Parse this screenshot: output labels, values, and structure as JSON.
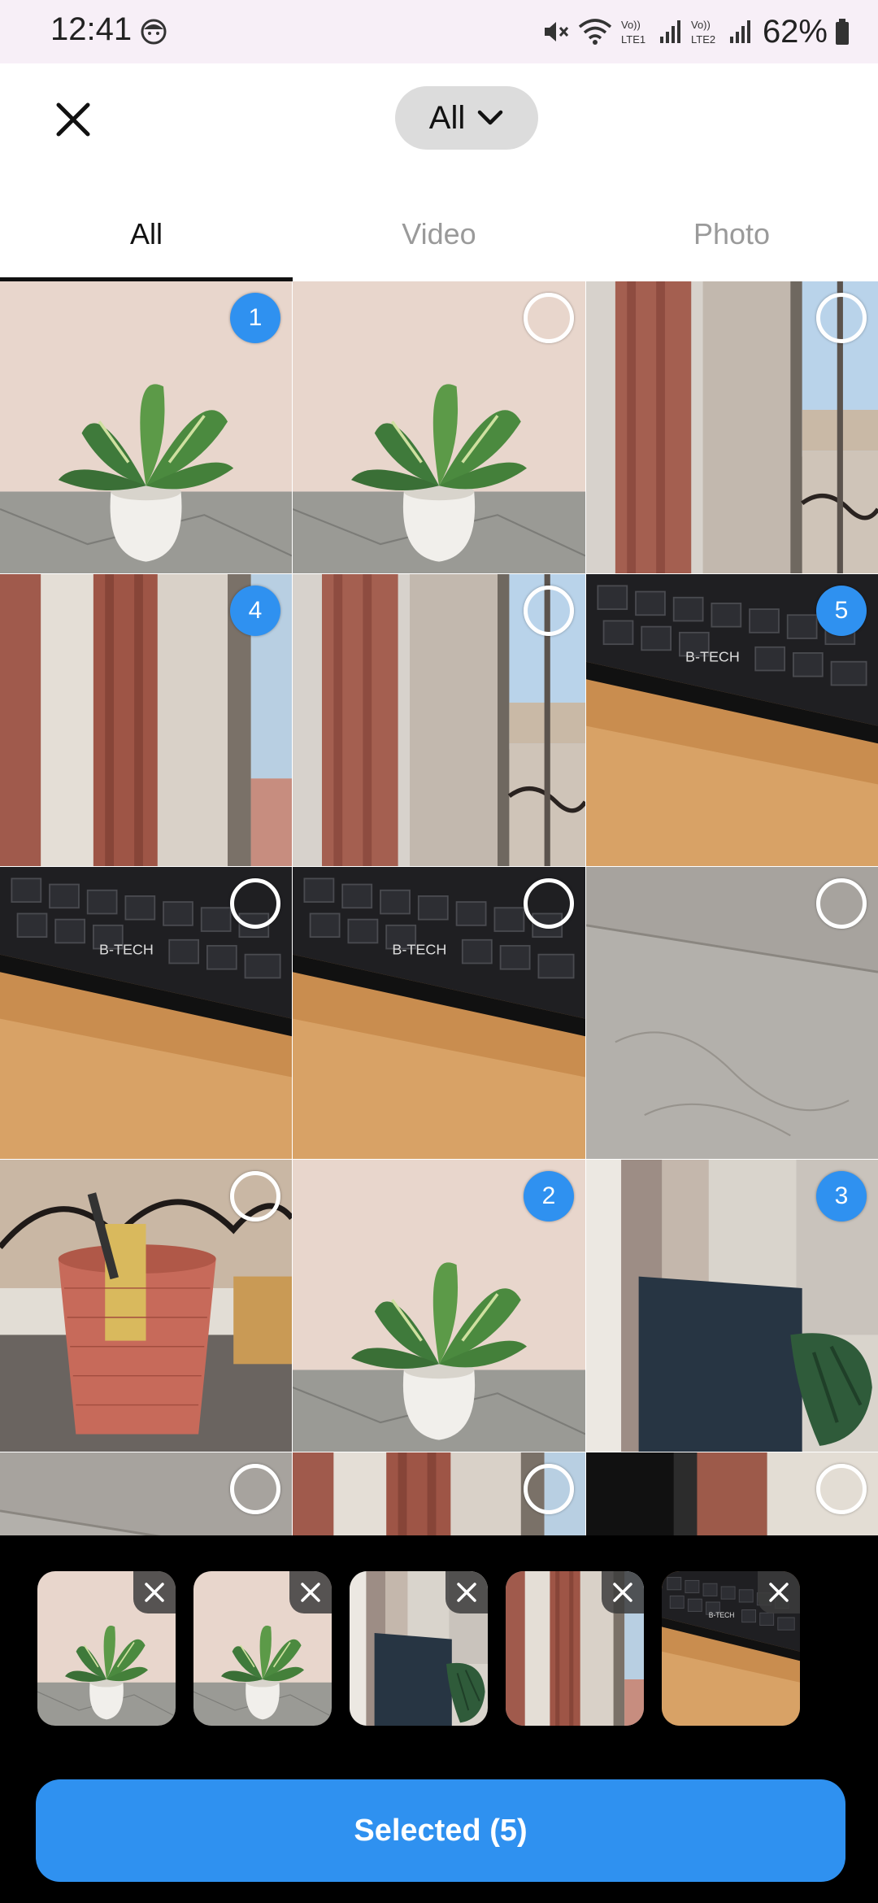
{
  "status_bar": {
    "time": "12:41",
    "battery": "62%",
    "net1": "Vo)) LTE1",
    "net2": "Vo)) LTE2",
    "icons": [
      "face-icon",
      "mute-icon",
      "wifi-icon",
      "signal-icon",
      "battery-icon"
    ]
  },
  "header": {
    "close_icon": "close-icon",
    "album_label": "All",
    "album_icon": "chevron-down-icon"
  },
  "tabs": [
    {
      "label": "All",
      "active": true
    },
    {
      "label": "Video",
      "active": false
    },
    {
      "label": "Photo",
      "active": false
    }
  ],
  "grid": [
    {
      "photo": "plant",
      "badge": "1"
    },
    {
      "photo": "plant",
      "badge": ""
    },
    {
      "photo": "window",
      "badge": ""
    },
    {
      "photo": "curtain",
      "badge": "4"
    },
    {
      "photo": "window",
      "badge": ""
    },
    {
      "photo": "keyboard",
      "badge": "5"
    },
    {
      "photo": "keyboard",
      "badge": ""
    },
    {
      "photo": "keyboard",
      "badge": ""
    },
    {
      "photo": "floor",
      "badge": ""
    },
    {
      "photo": "pencil-cup",
      "badge": ""
    },
    {
      "photo": "plant",
      "badge": "2"
    },
    {
      "photo": "monitor",
      "badge": "3"
    },
    {
      "photo": "floor",
      "badge": ""
    },
    {
      "photo": "curtain",
      "badge": ""
    },
    {
      "photo": "curtain-dark",
      "badge": ""
    }
  ],
  "selected_tray": [
    {
      "photo": "plant"
    },
    {
      "photo": "plant"
    },
    {
      "photo": "monitor"
    },
    {
      "photo": "curtain"
    },
    {
      "photo": "keyboard"
    }
  ],
  "footer": {
    "button_label": "Selected (5)"
  },
  "colors": {
    "accent": "#2f91f0",
    "tray_bg": "#000000",
    "status_bg": "#f7eff7"
  }
}
